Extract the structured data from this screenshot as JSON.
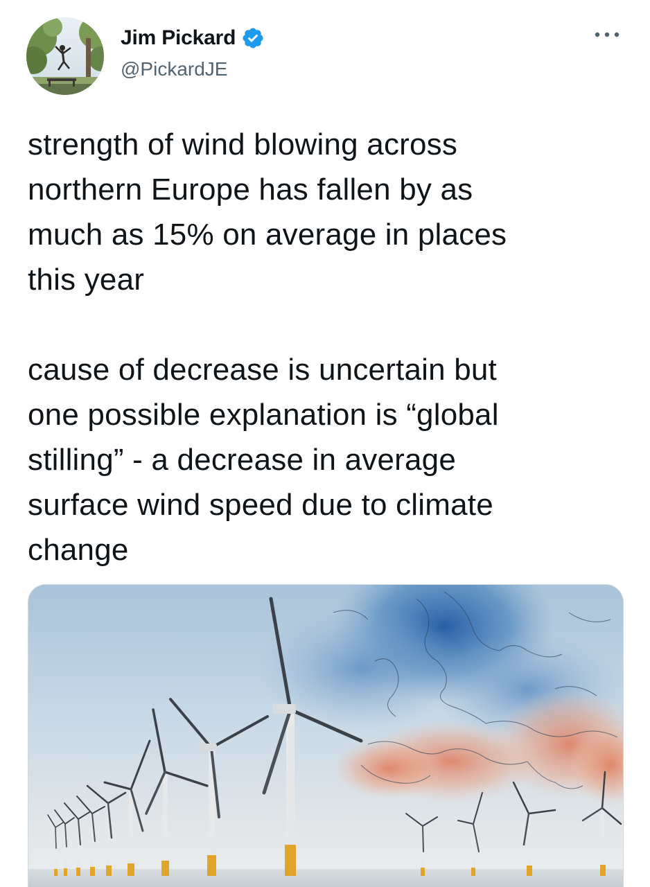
{
  "tweet": {
    "author": {
      "name": "Jim Pickard",
      "handle": "@PickardJE",
      "verified": true,
      "avatar_icon": "avatar-person-jumping-in-park"
    },
    "more_icon": "more-dots-icon",
    "text": {
      "paragraph_1": "strength of wind blowing across\nnorthern Europe has fallen by as\nmuch as 15% on average in places\nthis year",
      "paragraph_2": "cause of decrease is uncertain but\none possible explanation is “global\nstilling” - a decrease in average\nsurface wind speed due to climate\nchange"
    },
    "media": {
      "icon": "wind-turbines-over-europe-map-image"
    }
  },
  "colors": {
    "text": "#0f1419",
    "secondary": "#536471",
    "verified_blue": "#1d9bf0",
    "border": "#cfd9de"
  }
}
